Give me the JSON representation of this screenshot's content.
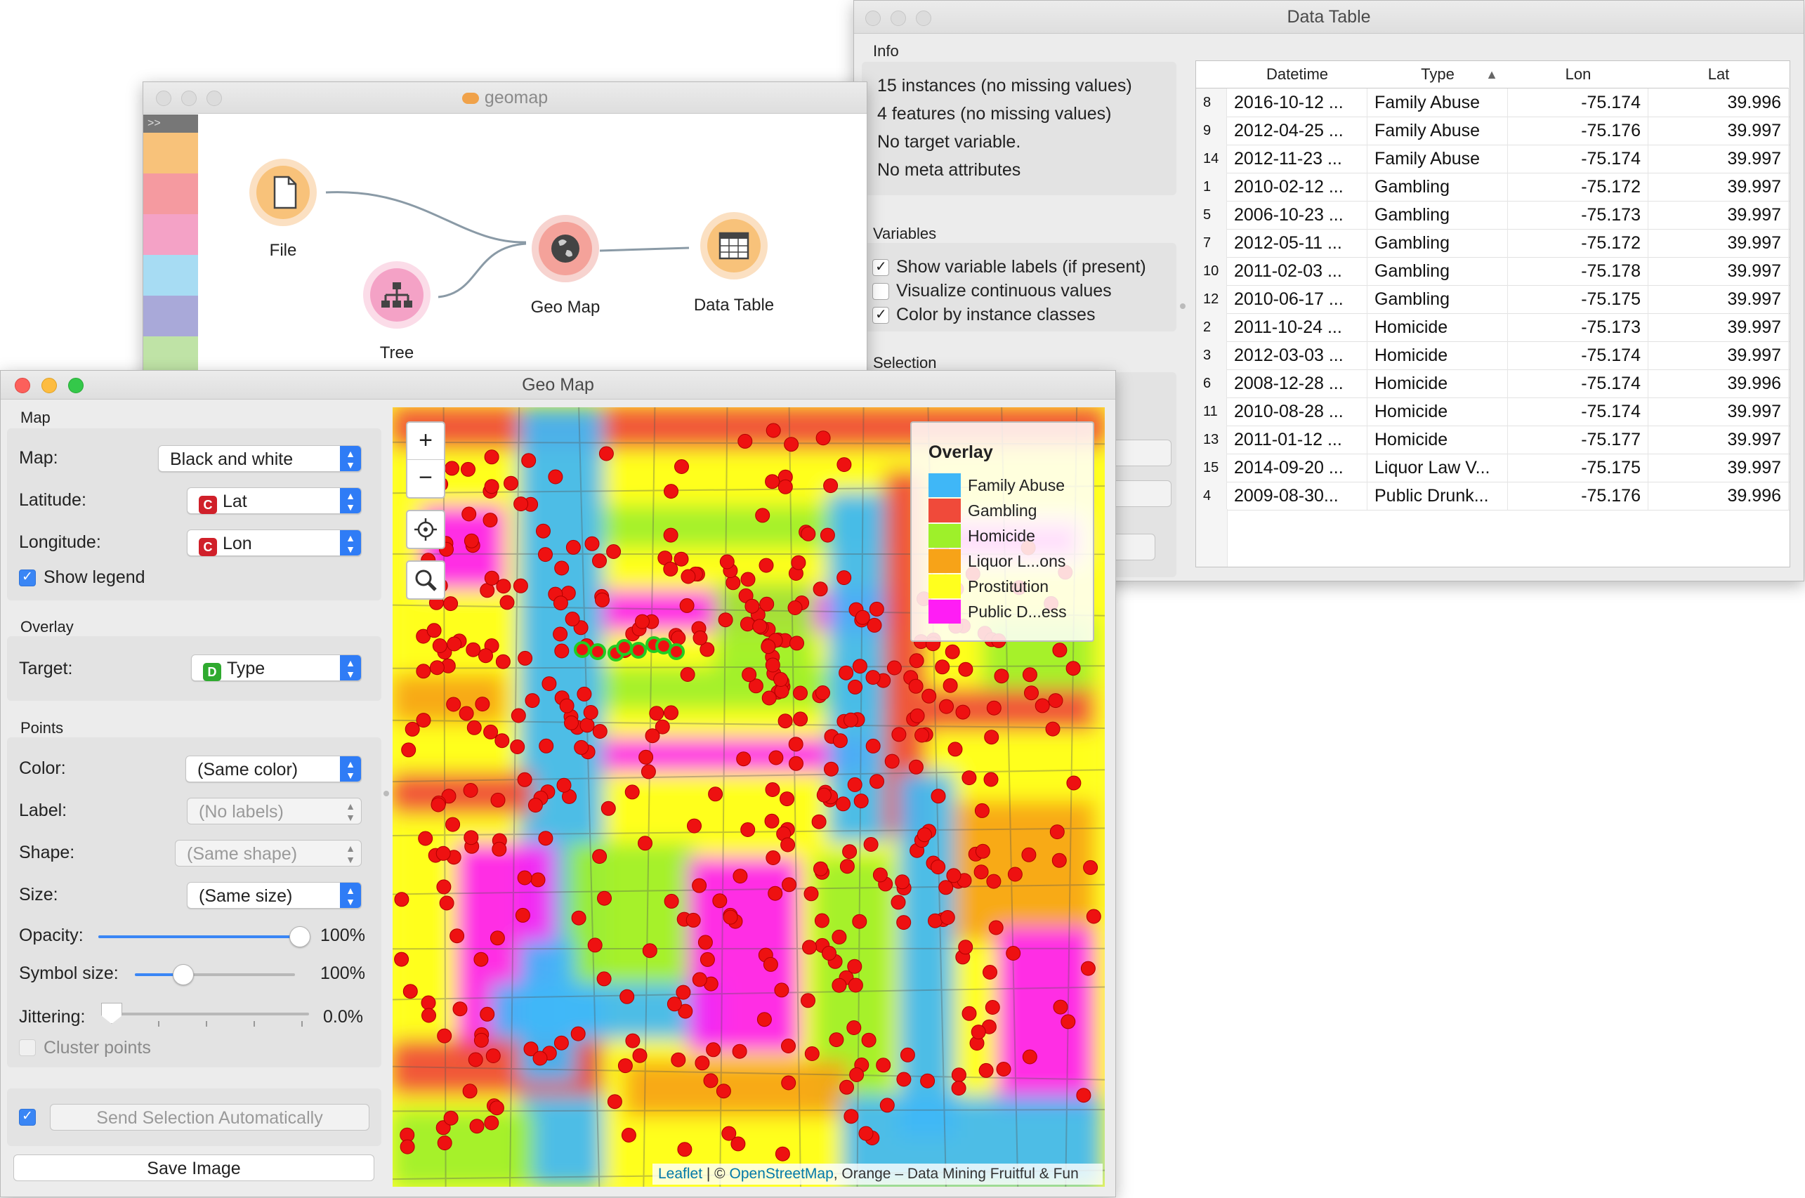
{
  "data_table": {
    "title": "Data Table",
    "info_label": "Info",
    "info_lines": [
      "15 instances (no missing values)",
      "4 features (no missing values)",
      "No target variable.",
      "No meta attributes"
    ],
    "variables_label": "Variables",
    "options": [
      {
        "label": "Show variable labels (if present)",
        "checked": true
      },
      {
        "label": "Visualize continuous values",
        "checked": false
      },
      {
        "label": "Color by instance classes",
        "checked": true
      }
    ],
    "selection_label": "Selection",
    "sort_indicator": "▲",
    "columns": [
      "Datetime",
      "Type",
      "Lon",
      "Lat"
    ],
    "rows": [
      {
        "idx": "8",
        "datetime": "2016-10-12 ...",
        "type": "Family Abuse",
        "lon": "-75.174",
        "lat": "39.996"
      },
      {
        "idx": "9",
        "datetime": "2012-04-25 ...",
        "type": "Family Abuse",
        "lon": "-75.176",
        "lat": "39.997"
      },
      {
        "idx": "14",
        "datetime": "2012-11-23 ...",
        "type": "Family Abuse",
        "lon": "-75.174",
        "lat": "39.997"
      },
      {
        "idx": "1",
        "datetime": "2010-02-12 ...",
        "type": "Gambling",
        "lon": "-75.172",
        "lat": "39.997"
      },
      {
        "idx": "5",
        "datetime": "2006-10-23 ...",
        "type": "Gambling",
        "lon": "-75.173",
        "lat": "39.997"
      },
      {
        "idx": "7",
        "datetime": "2012-05-11 ...",
        "type": "Gambling",
        "lon": "-75.172",
        "lat": "39.997"
      },
      {
        "idx": "10",
        "datetime": "2011-02-03 ...",
        "type": "Gambling",
        "lon": "-75.178",
        "lat": "39.997"
      },
      {
        "idx": "12",
        "datetime": "2010-06-17 ...",
        "type": "Gambling",
        "lon": "-75.175",
        "lat": "39.997"
      },
      {
        "idx": "2",
        "datetime": "2011-10-24 ...",
        "type": "Homicide",
        "lon": "-75.173",
        "lat": "39.997"
      },
      {
        "idx": "3",
        "datetime": "2012-03-03 ...",
        "type": "Homicide",
        "lon": "-75.174",
        "lat": "39.997"
      },
      {
        "idx": "6",
        "datetime": "2008-12-28 ...",
        "type": "Homicide",
        "lon": "-75.174",
        "lat": "39.996"
      },
      {
        "idx": "11",
        "datetime": "2010-08-28 ...",
        "type": "Homicide",
        "lon": "-75.174",
        "lat": "39.997"
      },
      {
        "idx": "13",
        "datetime": "2011-01-12 ...",
        "type": "Homicide",
        "lon": "-75.177",
        "lat": "39.997"
      },
      {
        "idx": "15",
        "datetime": "2014-09-20 ...",
        "type": "Liquor Law V...",
        "lon": "-75.175",
        "lat": "39.997"
      },
      {
        "idx": "4",
        "datetime": "2009-08-30...",
        "type": "Public Drunk...",
        "lon": "-75.176",
        "lat": "39.996"
      }
    ]
  },
  "canvas": {
    "title": "geomap",
    "collapse_glyph": ">>",
    "nodes": [
      {
        "label": "File",
        "icon": "file-icon"
      },
      {
        "label": "Tree",
        "icon": "tree-icon"
      },
      {
        "label": "Geo Map",
        "icon": "globe-icon"
      },
      {
        "label": "Data Table",
        "icon": "table-icon"
      }
    ],
    "palette_colors": [
      "#f8c27a",
      "#f59aa0",
      "#f4a2c6",
      "#a7dcf3",
      "#a9a9d9"
    ]
  },
  "geomap": {
    "title": "Geo Map",
    "map_section": "Map",
    "map_label": "Map:",
    "map_value": "Black and white",
    "latitude_label": "Latitude:",
    "latitude_tag": "C",
    "latitude_value": "Lat",
    "longitude_label": "Longitude:",
    "longitude_tag": "C",
    "longitude_value": "Lon",
    "show_legend": "Show legend",
    "overlay_section": "Overlay",
    "target_label": "Target:",
    "target_tag": "D",
    "target_value": "Type",
    "points_section": "Points",
    "color_label": "Color:",
    "color_value": "(Same color)",
    "label_label": "Label:",
    "label_value": "(No labels)",
    "shape_label": "Shape:",
    "shape_value": "(Same shape)",
    "size_label": "Size:",
    "size_value": "(Same size)",
    "opacity_label": "Opacity:",
    "opacity_value": "100%",
    "opacity_level": 1.0,
    "symbol_label": "Symbol size:",
    "symbol_value": "100%",
    "symbol_level": 0.27,
    "jitter_label": "Jittering:",
    "jitter_value": "0.0%",
    "jitter_level": 0.0,
    "cluster_label": "Cluster points",
    "send_label": "Send Selection Automatically",
    "save_label": "Save Image",
    "zoom_in": "+",
    "zoom_out": "−",
    "legend_title": "Overlay",
    "legend": [
      {
        "label": "Family Abuse",
        "color": "#3fb7f7"
      },
      {
        "label": "Gambling",
        "color": "#f04a3a"
      },
      {
        "label": "Homicide",
        "color": "#9ef02a"
      },
      {
        "label": "Liquor L...ons",
        "color": "#f7a318"
      },
      {
        "label": "Prostitution",
        "color": "#ffff1e"
      },
      {
        "label": "Public D...ess",
        "color": "#ff1df5"
      }
    ],
    "attribution_leaflet": "Leaflet",
    "attribution_sep": " | © ",
    "attribution_osm": "OpenStreetMap",
    "attribution_rest": ", Orange – Data Mining Fruitful & Fun",
    "point_color": "#ee1111"
  }
}
